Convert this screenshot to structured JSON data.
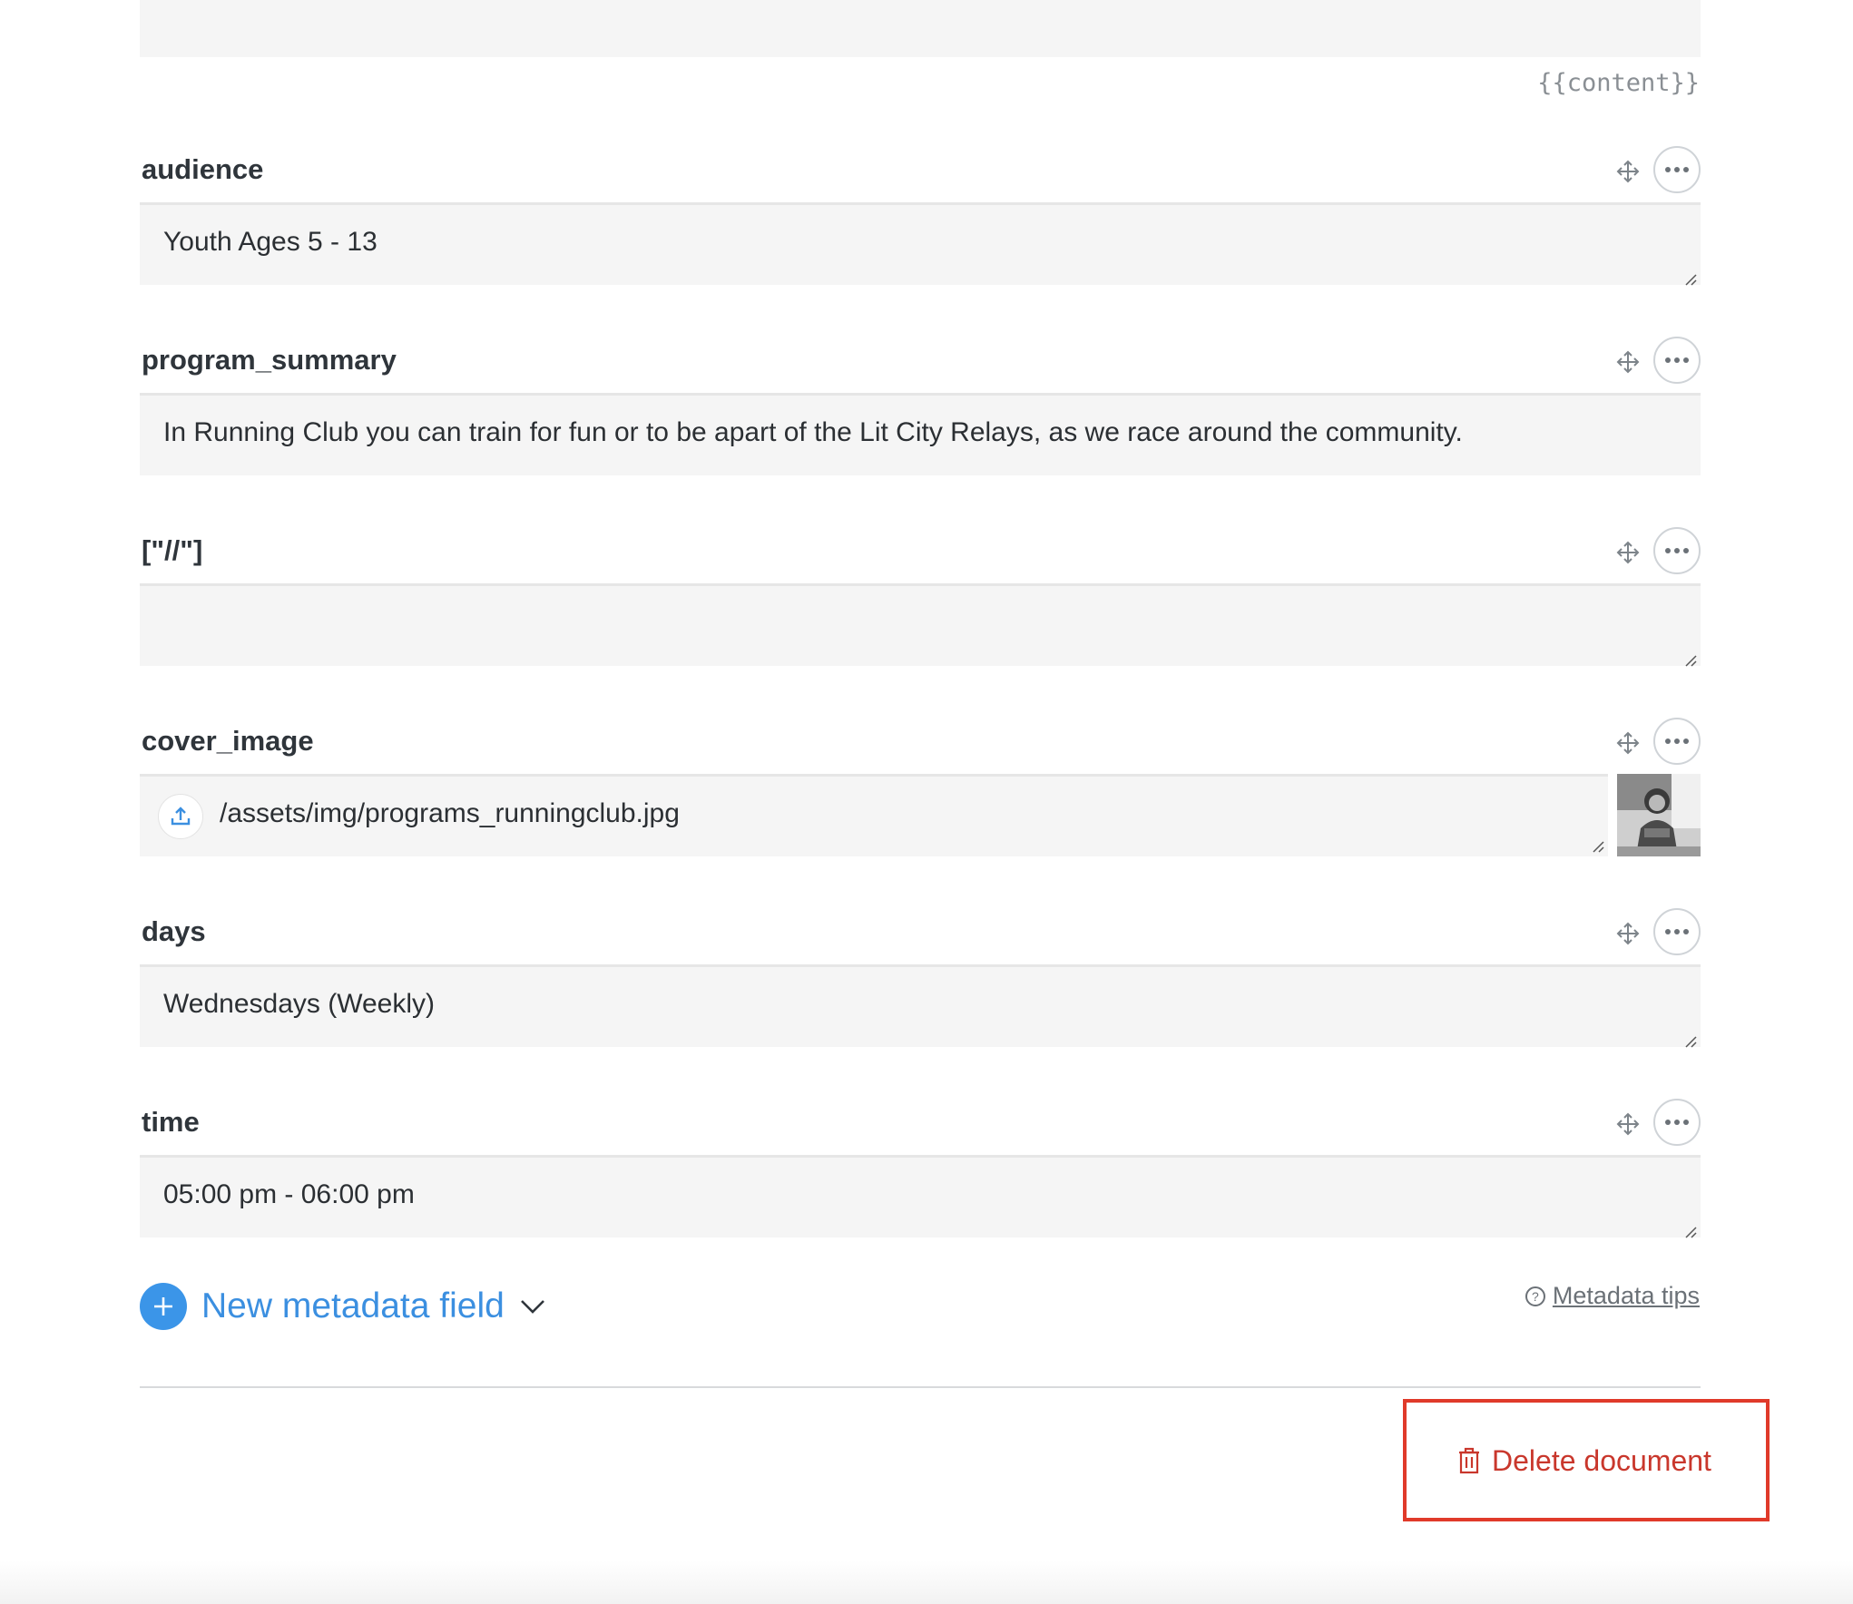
{
  "content_hint": "{{content}}",
  "fields": [
    {
      "label": "audience",
      "value": "Youth Ages 5 - 13"
    },
    {
      "label": "program_summary",
      "value": "In Running Club you can train for fun or to be apart of the Lit City Relays, as we race around the community."
    },
    {
      "label": "[\"//\"]",
      "value": ""
    },
    {
      "label": "cover_image",
      "value": "/assets/img/programs_runningclub.jpg"
    },
    {
      "label": "days",
      "value": "Wednesdays (Weekly)"
    },
    {
      "label": "time",
      "value": "05:00 pm - 06:00 pm"
    }
  ],
  "footer": {
    "new_field_label": "New metadata field",
    "tips_label": "Metadata tips",
    "delete_label": "Delete document"
  },
  "colors": {
    "accent": "#3b95e8",
    "danger": "#c9372c",
    "highlight_frame": "#e03a2a"
  },
  "icons": [
    "move-icon",
    "more-icon",
    "upload-icon",
    "plus-icon",
    "chevron-down-icon",
    "help-icon",
    "trash-icon"
  ]
}
